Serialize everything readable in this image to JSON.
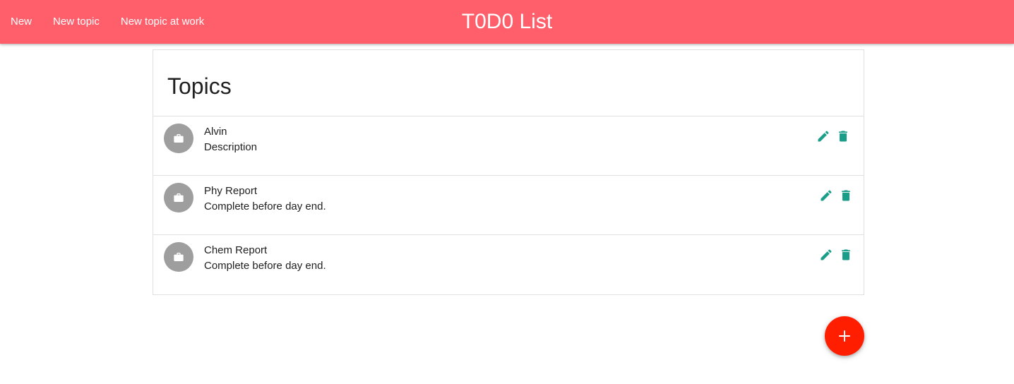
{
  "nav": {
    "links": [
      "New",
      "New topic",
      "New topic at work"
    ],
    "brand": "T0D0 List"
  },
  "topics": {
    "heading": "Topics",
    "items": [
      {
        "title": "Alvin",
        "description": "Description",
        "icon": "briefcase-icon"
      },
      {
        "title": "Phy Report",
        "description": "Complete before day end.",
        "icon": "briefcase-icon"
      },
      {
        "title": "Chem Report",
        "description": "Complete before day end.",
        "icon": "briefcase-icon"
      }
    ]
  },
  "fab": {
    "icon": "plus-icon"
  },
  "colors": {
    "navbar": "#ff5f6b",
    "action_icons": "#1a9e8a",
    "avatar": "#9e9e9e",
    "fab": "#ff1f00"
  }
}
